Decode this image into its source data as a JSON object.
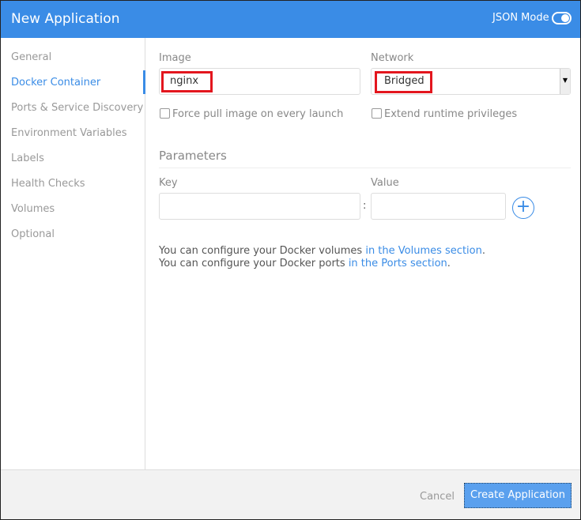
{
  "header": {
    "title": "New Application",
    "json_mode_label": "JSON Mode",
    "json_mode_on": false
  },
  "sidebar": {
    "items": [
      {
        "label": "General"
      },
      {
        "label": "Docker Container"
      },
      {
        "label": "Ports & Service Discovery"
      },
      {
        "label": "Environment Variables"
      },
      {
        "label": "Labels"
      },
      {
        "label": "Health Checks"
      },
      {
        "label": "Volumes"
      },
      {
        "label": "Optional"
      }
    ],
    "active": "Docker Container"
  },
  "form": {
    "image_label": "Image",
    "image_value": "nginx",
    "network_label": "Network",
    "network_value": "Bridged",
    "force_pull_label": "Force pull image on every launch",
    "extend_priv_label": "Extend runtime privileges",
    "parameters_title": "Parameters",
    "key_label": "Key",
    "value_label": "Value",
    "separator": ":",
    "key_value": "",
    "value_value": ""
  },
  "info": {
    "volumes_prefix": "You can configure your Docker volumes ",
    "volumes_link": "in the Volumes section",
    "ports_prefix": "You can configure your Docker ports ",
    "ports_link": "in the Ports section",
    "suffix": "."
  },
  "footer": {
    "cancel_label": "Cancel",
    "create_label": "Create Application"
  },
  "colors": {
    "accent": "#3a8ce6",
    "highlight": "#e3161e"
  }
}
